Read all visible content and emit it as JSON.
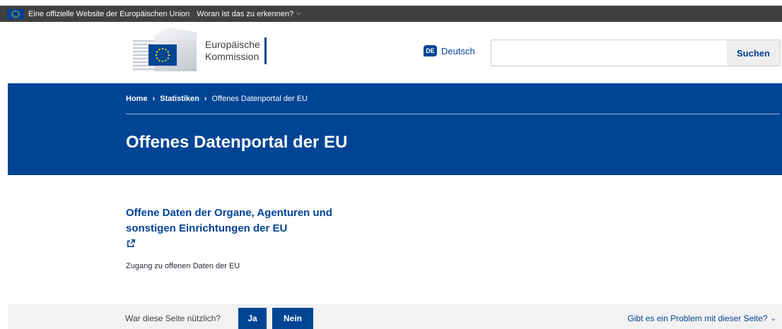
{
  "globan": {
    "official_text": "Eine offizielle Website der Europäischen Union",
    "howto_text": "Woran ist das zu erkennen?",
    "flag_icon": "eu-flag-icon",
    "chevron_icon": "chevron-down-icon"
  },
  "header": {
    "logo_line1": "Europäische",
    "logo_line2": "Kommission",
    "language_code": "DE",
    "language_label": "Deutsch",
    "search_placeholder": "",
    "search_button": "Suchen"
  },
  "breadcrumb": {
    "items": [
      "Home",
      "Statistiken",
      "Offenes Datenportal der EU"
    ]
  },
  "page": {
    "title": "Offenes Datenportal der EU"
  },
  "content": {
    "link_title": "Offene Daten der Organe, Agenturen und sonstigen Einrichtungen der EU",
    "external_icon": "external-link-icon",
    "description": "Zugang zu offenen Daten der EU"
  },
  "feedback": {
    "question": "War diese Seite nützlich?",
    "yes": "Ja",
    "no": "Nein",
    "problem": "Gibt es ein Problem mit dieser Seite?"
  },
  "colors": {
    "eu_blue": "#004494",
    "banner_dark": "#404040",
    "feedback_bg": "#f2f2f2"
  }
}
